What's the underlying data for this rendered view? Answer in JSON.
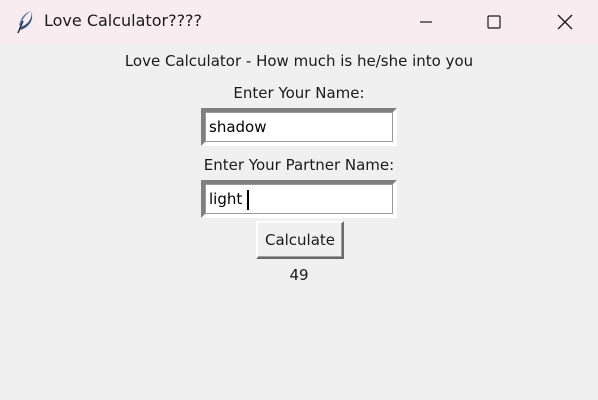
{
  "window": {
    "title": "Love Calculator????",
    "icon": "feather-icon",
    "controls": [
      "minimize-icon",
      "maximize-icon",
      "close-icon"
    ]
  },
  "main": {
    "heading": "Love Calculator - How much is he/she into you",
    "name_label": "Enter Your Name:",
    "name_value": "shadow",
    "partner_label": "Enter Your Partner Name:",
    "partner_value": "light",
    "calculate_label": "Calculate",
    "result": "49"
  }
}
